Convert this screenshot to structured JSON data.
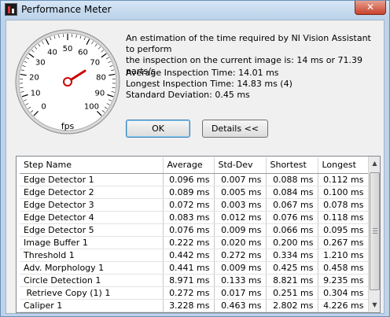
{
  "window": {
    "title": "Performance Meter",
    "close_glyph": "✕"
  },
  "gauge": {
    "unit": "fps",
    "ticks": [
      "0",
      "10",
      "20",
      "30",
      "40",
      "50",
      "60",
      "70",
      "80",
      "90",
      "100"
    ],
    "value": 71.39,
    "needle_color": "#cc0000"
  },
  "info": {
    "line1": "An estimation of the time required by NI Vision Assistant to perform",
    "line2": "the inspection on the current image is:  14 ms or 71.39 parts/s.",
    "avg": "Average Inspection Time:  14.01 ms",
    "longest": "Longest Inspection Time:  14.83 ms (4)",
    "stddev": "Standard Deviation: 0.45 ms"
  },
  "buttons": {
    "ok": "OK",
    "details": "Details <<"
  },
  "table": {
    "headers": [
      "Step Name",
      "Average",
      "Std-Dev",
      "Shortest",
      "Longest"
    ],
    "rows": [
      [
        "Edge Detector 1",
        "0.096 ms",
        "0.007 ms",
        "0.088 ms",
        "0.112 ms"
      ],
      [
        "Edge Detector 2",
        "0.089 ms",
        "0.005 ms",
        "0.084 ms",
        "0.100 ms"
      ],
      [
        "Edge Detector 3",
        "0.072 ms",
        "0.003 ms",
        "0.067 ms",
        "0.078 ms"
      ],
      [
        "Edge Detector 4",
        "0.083 ms",
        "0.012 ms",
        "0.076 ms",
        "0.118 ms"
      ],
      [
        "Edge Detector 5",
        "0.076 ms",
        "0.009 ms",
        "0.066 ms",
        "0.095 ms"
      ],
      [
        "Image Buffer 1",
        "0.222 ms",
        "0.020 ms",
        "0.200 ms",
        "0.267 ms"
      ],
      [
        "Threshold 1",
        "0.442 ms",
        "0.272 ms",
        "0.334 ms",
        "1.210 ms"
      ],
      [
        "Adv. Morphology 1",
        "0.441 ms",
        "0.009 ms",
        "0.425 ms",
        "0.458 ms"
      ],
      [
        "Circle Detection 1",
        "8.971 ms",
        "0.133 ms",
        "8.821 ms",
        "9.235 ms"
      ],
      [
        " Retrieve Copy (1) 1",
        "0.272 ms",
        "0.017 ms",
        "0.251 ms",
        "0.304 ms"
      ],
      [
        "Caliper 1",
        "3.228 ms",
        "0.463 ms",
        "2.802 ms",
        "4.226 ms"
      ]
    ]
  }
}
